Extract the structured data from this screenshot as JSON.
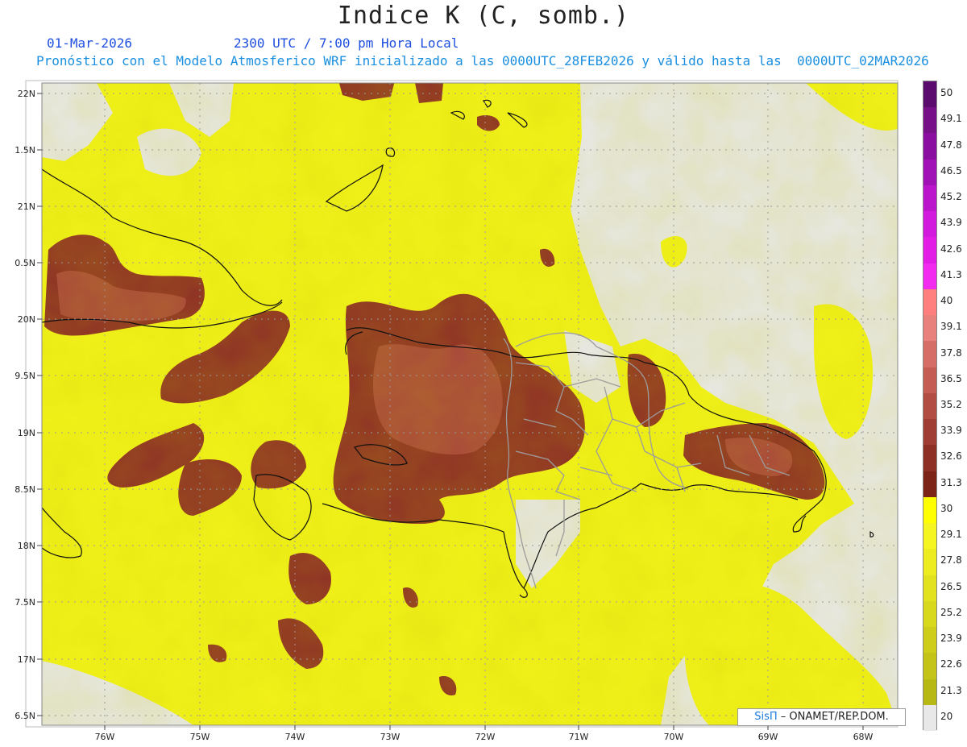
{
  "header": {
    "title": "Indice K (C, somb.)",
    "date": "01-Mar-2026",
    "time": "2300 UTC / 7:00 pm Hora Local",
    "forecast": "Pronóstico con el Modelo Atmosferico WRF inicializado a las 0000UTC_28FEB2026 y válido hasta las  0000UTC_02MAR2026"
  },
  "map": {
    "lat_labels": [
      "22N",
      "1.5N",
      "21N",
      "0.5N",
      "20N",
      "9.5N",
      "19N",
      "8.5N",
      "18N",
      "7.5N",
      "17N",
      "6.5N"
    ],
    "lon_labels": [
      "76W",
      "75W",
      "74W",
      "73W",
      "72W",
      "71W",
      "70W",
      "69W",
      "68W"
    ]
  },
  "colorbar": {
    "labels": [
      "50",
      "49.1",
      "47.8",
      "46.5",
      "45.2",
      "43.9",
      "42.6",
      "41.3",
      "40",
      "39.1",
      "37.8",
      "36.5",
      "35.2",
      "33.9",
      "32.6",
      "31.3",
      "30",
      "29.1",
      "27.8",
      "26.5",
      "25.2",
      "23.9",
      "22.6",
      "21.3",
      "20"
    ],
    "colors": [
      "#5b0a6e",
      "#760f88",
      "#8a0ea0",
      "#a012b5",
      "#bb16cc",
      "#d21ade",
      "#e21ee6",
      "#f22af0",
      "#ff7f7f",
      "#e8807b",
      "#d46e66",
      "#c45e55",
      "#b24d44",
      "#a03e35",
      "#8e3026",
      "#7c2417",
      "#ffff00",
      "#f5f521",
      "#ecec20",
      "#e2e21e",
      "#d8d81c",
      "#cece1a",
      "#c4c418",
      "#b8b814",
      "#e8e8e8"
    ]
  },
  "credit": {
    "brand": "SisΠ",
    "text": "– ONAMET/REP.DOM."
  }
}
